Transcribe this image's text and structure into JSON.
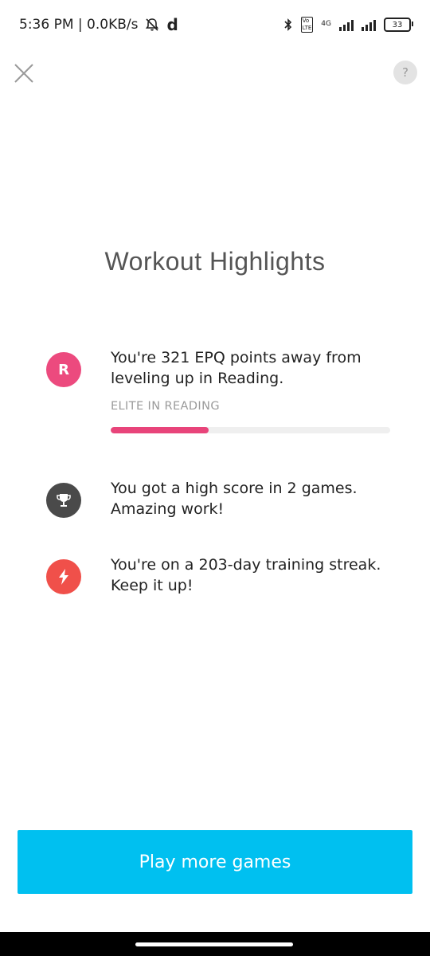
{
  "status_bar": {
    "time_info": "5:36 PM | 0.0KB/s",
    "app_letter": "d",
    "network": "4G",
    "battery": "33"
  },
  "header": {
    "close_icon": "close-icon",
    "help_label": "?"
  },
  "title": "Workout Highlights",
  "highlights": [
    {
      "icon_letter": "R",
      "icon_color": "#ec4a7e",
      "text": "You're 321 EPQ points away from leveling up in Reading.",
      "sub_label": "ELITE IN READING",
      "progress_fraction": 0.35,
      "progress_color": "#e8447a"
    },
    {
      "icon": "trophy-icon",
      "icon_color": "#4a4a4a",
      "text": "You got a high score in 2 games. Amazing work!"
    },
    {
      "icon": "lightning-icon",
      "icon_color": "#f0504a",
      "text": "You're on a 203-day training streak. Keep it up!"
    }
  ],
  "cta": {
    "label": "Play more games",
    "color": "#00c0f0"
  }
}
